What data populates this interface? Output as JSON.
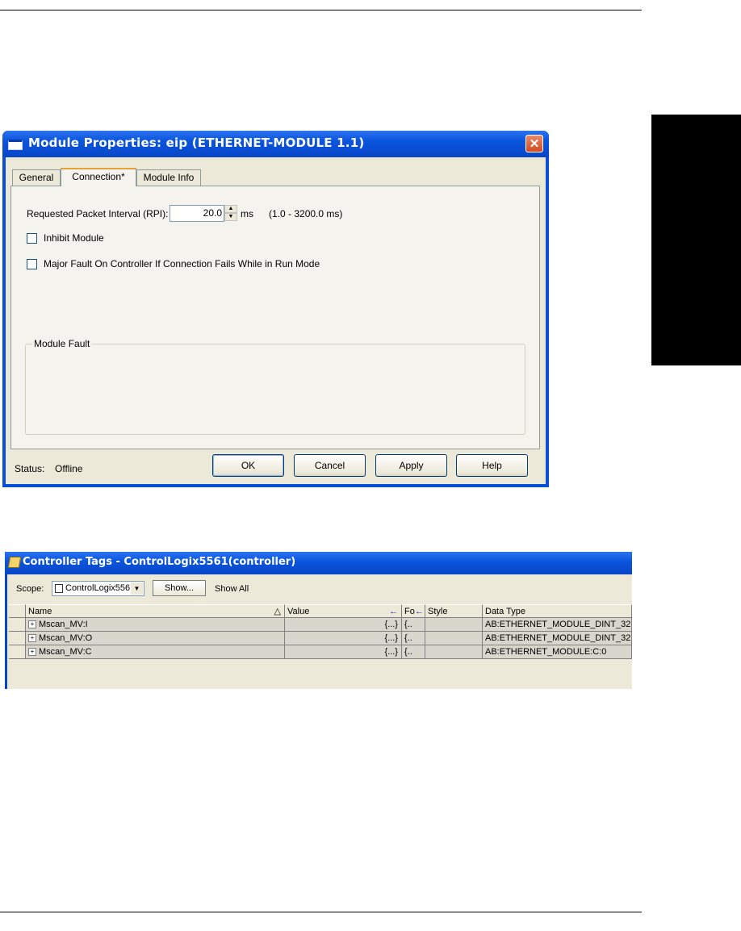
{
  "dialog": {
    "title": "Module Properties: eip (ETHERNET-MODULE 1.1)",
    "close_glyph": "✕",
    "tabs": [
      {
        "label": "General"
      },
      {
        "label": "Connection*"
      },
      {
        "label": "Module Info"
      }
    ],
    "rpi_label": "Requested Packet Interval (RPI):",
    "rpi_value": "20.0",
    "rpi_unit": "ms",
    "rpi_range": "(1.0 - 3200.0 ms)",
    "inhibit_label": "Inhibit Module",
    "major_fault_label": "Major Fault On Controller If Connection Fails While in Run Mode",
    "module_fault_group": "Module Fault",
    "status_label": "Status:",
    "status_value": "Offline",
    "buttons": {
      "ok": "OK",
      "cancel": "Cancel",
      "apply": "Apply",
      "help": "Help"
    }
  },
  "tags_window": {
    "title": "Controller Tags - ControlLogix5561(controller)",
    "scope_label": "Scope:",
    "scope_value": "ControlLogix556",
    "show_button": "Show...",
    "show_all": "Show All",
    "columns": [
      "Name",
      "Value",
      "Fo",
      "Style",
      "Data Type"
    ],
    "rows": [
      {
        "name": "Mscan_MV:I",
        "value": "{...}",
        "fo": "{..",
        "style": "",
        "data_type": "AB:ETHERNET_MODULE_DINT_32..."
      },
      {
        "name": "Mscan_MV:O",
        "value": "{...}",
        "fo": "{..",
        "style": "",
        "data_type": "AB:ETHERNET_MODULE_DINT_32..."
      },
      {
        "name": "Mscan_MV:C",
        "value": "{...}",
        "fo": "{..",
        "style": "",
        "data_type": "AB:ETHERNET_MODULE:C:0"
      }
    ]
  }
}
